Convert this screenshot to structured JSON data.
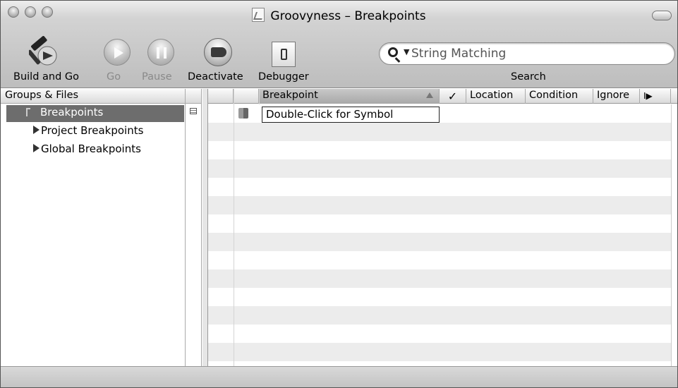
{
  "window": {
    "title": "Groovyness – Breakpoints"
  },
  "toolbar": {
    "build_and_go": "Build and Go",
    "go": "Go",
    "pause": "Pause",
    "deactivate": "Deactivate",
    "debugger": "Debugger",
    "search_label": "Search",
    "search_placeholder": "String Matching",
    "icons": {
      "build": "hammer-icon",
      "go": "play-icon",
      "pause": "pause-icon",
      "deactivate": "breakpoint-toggle-icon",
      "debugger": "debugger-icon",
      "search": "magnifier-icon"
    }
  },
  "sidebar": {
    "header": "Groups & Files",
    "items": [
      {
        "label": "Breakpoints",
        "selected": true
      },
      {
        "label": "Project Breakpoints",
        "selected": false
      },
      {
        "label": "Global Breakpoints",
        "selected": false
      }
    ]
  },
  "table": {
    "columns": {
      "breakpoint": "Breakpoint",
      "enabled": "✓",
      "location": "Location",
      "condition": "Condition",
      "ignore": "Ignore",
      "more": "I▶"
    },
    "rows": [
      {
        "breakpoint": "Double-Click for Symbol"
      }
    ]
  }
}
